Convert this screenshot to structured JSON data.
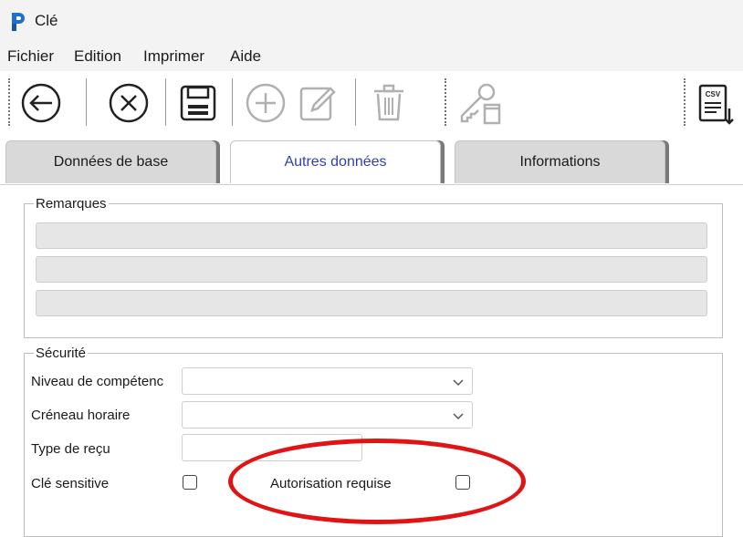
{
  "window": {
    "title": "Clé"
  },
  "menu": {
    "items": [
      "Fichier",
      "Edition",
      "Imprimer",
      "Aide"
    ]
  },
  "toolbar": {
    "buttons": [
      {
        "icon": "back-arrow-icon",
        "enabled": true
      },
      {
        "icon": "cancel-icon",
        "enabled": true
      },
      {
        "icon": "save-icon",
        "enabled": true
      },
      {
        "icon": "add-icon",
        "enabled": false
      },
      {
        "icon": "edit-icon",
        "enabled": false
      },
      {
        "icon": "delete-icon",
        "enabled": false
      },
      {
        "icon": "key-document-icon",
        "enabled": false
      },
      {
        "icon": "csv-export-icon",
        "enabled": true
      }
    ],
    "csv_label": "CSV"
  },
  "tabs": [
    {
      "label": "Données de base",
      "active": false
    },
    {
      "label": "Autres données",
      "active": true
    },
    {
      "label": "Informations",
      "active": false
    }
  ],
  "remarks": {
    "title": "Remarques",
    "lines": [
      "",
      "",
      ""
    ]
  },
  "security": {
    "title": "Sécurité",
    "skill_level": {
      "label": "Niveau de compétenc",
      "value": ""
    },
    "time_slot": {
      "label": "Créneau horaire",
      "value": ""
    },
    "receipt_type": {
      "label": "Type de reçu",
      "value": ""
    },
    "sensitive_key": {
      "label": "Clé sensitive",
      "checked": false
    },
    "authorization_required": {
      "label": "Autorisation requise",
      "checked": false
    }
  },
  "colors": {
    "active_tab_text": "#2f3fb3",
    "highlight_ellipse": "#e01414",
    "app_icon": "#1f6fd1"
  }
}
